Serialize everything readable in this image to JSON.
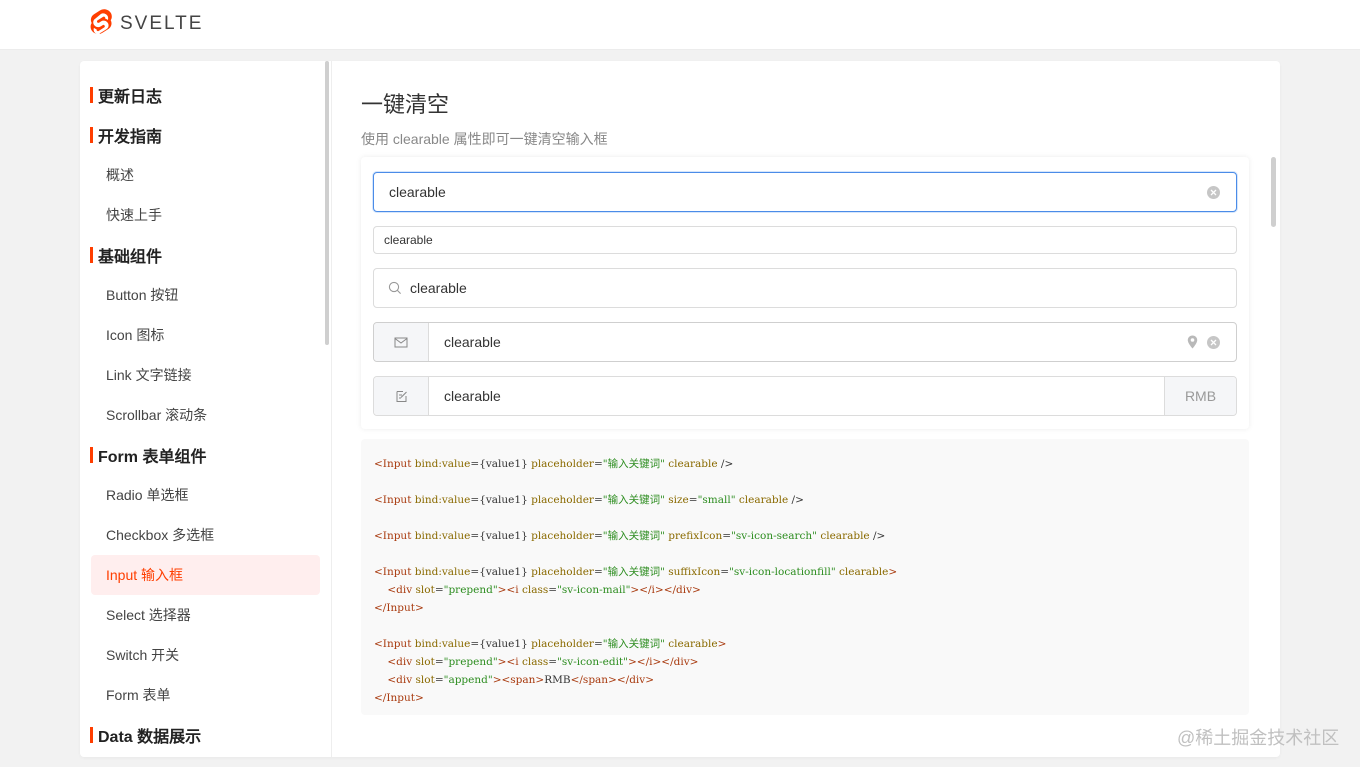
{
  "header": {
    "logo_text": "SVELTE",
    "brand_color": "#ff3e00"
  },
  "sidebar": {
    "groups": [
      {
        "label": "更新日志"
      },
      {
        "label": "开发指南",
        "items": [
          "概述",
          "快速上手"
        ]
      },
      {
        "label": "基础组件",
        "items": [
          "Button 按钮",
          "Icon 图标",
          "Link 文字链接",
          "Scrollbar 滚动条"
        ]
      },
      {
        "label": "Form 表单组件",
        "items": [
          "Radio 单选框",
          "Checkbox 多选框",
          "Input 输入框",
          "Select 选择器",
          "Switch 开关",
          "Form 表单"
        ]
      },
      {
        "label": "Data 数据展示"
      }
    ],
    "active_item": "Input 输入框"
  },
  "main": {
    "title": "一键清空",
    "description": "使用 clearable 属性即可一键清空输入框",
    "inputs": [
      {
        "value": "clearable",
        "icon": "clear-icon"
      },
      {
        "value": "clearable",
        "size": "small"
      },
      {
        "value": "clearable",
        "prefix_icon": "search-icon"
      },
      {
        "value": "clearable",
        "prepend_icon": "mail-icon",
        "suffix_icon": "location-icon"
      },
      {
        "value": "clearable",
        "prepend_icon": "edit-icon",
        "append_text": "RMB"
      }
    ],
    "code": {
      "l1": [
        [
          "tag",
          "<Input "
        ],
        [
          "attr",
          "bind:value"
        ],
        [
          "plain",
          "={value1} "
        ],
        [
          "attr",
          "placeholder"
        ],
        [
          "plain",
          "="
        ],
        [
          "str",
          "\"输入关键词\""
        ],
        [
          "plain",
          " "
        ],
        [
          "attr",
          "clearable"
        ],
        [
          "plain",
          " />"
        ]
      ],
      "l2": [
        [
          "tag",
          "<Input "
        ],
        [
          "attr",
          "bind:value"
        ],
        [
          "plain",
          "={value1} "
        ],
        [
          "attr",
          "placeholder"
        ],
        [
          "plain",
          "="
        ],
        [
          "str",
          "\"输入关键词\""
        ],
        [
          "plain",
          " "
        ],
        [
          "attr",
          "size"
        ],
        [
          "plain",
          "="
        ],
        [
          "str",
          "\"small\""
        ],
        [
          "plain",
          " "
        ],
        [
          "attr",
          "clearable"
        ],
        [
          "plain",
          " />"
        ]
      ],
      "l3": [
        [
          "tag",
          "<Input "
        ],
        [
          "attr",
          "bind:value"
        ],
        [
          "plain",
          "={value1} "
        ],
        [
          "attr",
          "placeholder"
        ],
        [
          "plain",
          "="
        ],
        [
          "str",
          "\"输入关键词\""
        ],
        [
          "plain",
          " "
        ],
        [
          "attr",
          "prefixIcon"
        ],
        [
          "plain",
          "="
        ],
        [
          "str",
          "\"sv-icon-search\""
        ],
        [
          "plain",
          " "
        ],
        [
          "attr",
          "clearable"
        ],
        [
          "plain",
          " />"
        ]
      ],
      "l4": [
        [
          "tag",
          "<Input "
        ],
        [
          "attr",
          "bind:value"
        ],
        [
          "plain",
          "={value1} "
        ],
        [
          "attr",
          "placeholder"
        ],
        [
          "plain",
          "="
        ],
        [
          "str",
          "\"输入关键词\""
        ],
        [
          "plain",
          " "
        ],
        [
          "attr",
          "suffixIcon"
        ],
        [
          "plain",
          "="
        ],
        [
          "str",
          "\"sv-icon-locationfill\""
        ],
        [
          "plain",
          " "
        ],
        [
          "attr",
          "clearable"
        ],
        [
          "tag",
          ">"
        ]
      ],
      "l5": [
        [
          "plain",
          "    "
        ],
        [
          "tag",
          "<div "
        ],
        [
          "attr",
          "slot"
        ],
        [
          "plain",
          "="
        ],
        [
          "str",
          "\"prepend\""
        ],
        [
          "tag",
          "><i "
        ],
        [
          "attr",
          "class"
        ],
        [
          "plain",
          "="
        ],
        [
          "str",
          "\"sv-icon-mail\""
        ],
        [
          "tag",
          "></i></div>"
        ]
      ],
      "l6": [
        [
          "tag",
          "</Input>"
        ]
      ],
      "l7": [
        [
          "tag",
          "<Input "
        ],
        [
          "attr",
          "bind:value"
        ],
        [
          "plain",
          "={value1} "
        ],
        [
          "attr",
          "placeholder"
        ],
        [
          "plain",
          "="
        ],
        [
          "str",
          "\"输入关键词\""
        ],
        [
          "plain",
          " "
        ],
        [
          "attr",
          "clearable"
        ],
        [
          "tag",
          ">"
        ]
      ],
      "l8": [
        [
          "plain",
          "    "
        ],
        [
          "tag",
          "<div "
        ],
        [
          "attr",
          "slot"
        ],
        [
          "plain",
          "="
        ],
        [
          "str",
          "\"prepend\""
        ],
        [
          "tag",
          "><i "
        ],
        [
          "attr",
          "class"
        ],
        [
          "plain",
          "="
        ],
        [
          "str",
          "\"sv-icon-edit\""
        ],
        [
          "tag",
          "></i></div>"
        ]
      ],
      "l9": [
        [
          "plain",
          "    "
        ],
        [
          "tag",
          "<div "
        ],
        [
          "attr",
          "slot"
        ],
        [
          "plain",
          "="
        ],
        [
          "str",
          "\"append\""
        ],
        [
          "tag",
          "><span>"
        ],
        [
          "plain",
          "RMB"
        ],
        [
          "tag",
          "</span></div>"
        ]
      ],
      "l10": [
        [
          "tag",
          "</Input>"
        ]
      ]
    }
  },
  "watermark": "@稀土掘金技术社区"
}
